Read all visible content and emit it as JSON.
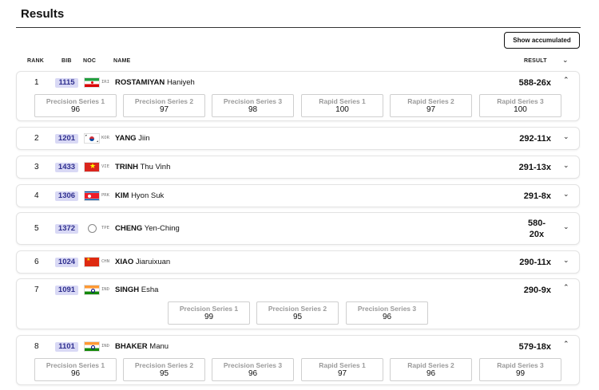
{
  "page": {
    "title": "Results",
    "show_accumulated_label": "Show accumulated"
  },
  "columns": {
    "rank": "RANK",
    "bib": "BIB",
    "noc": "NOC",
    "name": "NAME",
    "result": "RESULT"
  },
  "icons": {
    "expanded": "chevron-up-icon",
    "collapsed": "chevron-down-icon"
  },
  "rows": [
    {
      "rank": "1",
      "bib": "1115",
      "noc": "IRI",
      "surname": "ROSTAMIYAN",
      "given": "Haniyeh",
      "result": "588-26x",
      "expanded": true,
      "series": [
        {
          "label": "Precision Series 1",
          "value": "96"
        },
        {
          "label": "Precision Series 2",
          "value": "97"
        },
        {
          "label": "Precision Series 3",
          "value": "98"
        },
        {
          "label": "Rapid Series 1",
          "value": "100"
        },
        {
          "label": "Rapid Series 2",
          "value": "97"
        },
        {
          "label": "Rapid Series 3",
          "value": "100"
        }
      ]
    },
    {
      "rank": "2",
      "bib": "1201",
      "noc": "KOR",
      "surname": "YANG",
      "given": "Jiin",
      "result": "292-11x",
      "expanded": false
    },
    {
      "rank": "3",
      "bib": "1433",
      "noc": "VIE",
      "surname": "TRINH",
      "given": "Thu Vinh",
      "result": "291-13x",
      "expanded": false
    },
    {
      "rank": "4",
      "bib": "1306",
      "noc": "PRK",
      "surname": "KIM",
      "given": "Hyon Suk",
      "result": "291-8x",
      "expanded": false
    },
    {
      "rank": "5",
      "bib": "1372",
      "noc": "TPE",
      "surname": "CHENG",
      "given": "Yen-Ching",
      "result_line1": "580-",
      "result_line2": "20x",
      "expanded": false
    },
    {
      "rank": "6",
      "bib": "1024",
      "noc": "CHN",
      "surname": "XIAO",
      "given": "Jiaruixuan",
      "result": "290-11x",
      "expanded": false
    },
    {
      "rank": "7",
      "bib": "1091",
      "noc": "IND",
      "surname": "SINGH",
      "given": "Esha",
      "result": "290-9x",
      "expanded": true,
      "series": [
        {
          "label": "Precision Series 1",
          "value": "99"
        },
        {
          "label": "Precision Series 2",
          "value": "95"
        },
        {
          "label": "Precision Series 3",
          "value": "96"
        }
      ]
    },
    {
      "rank": "8",
      "bib": "1101",
      "noc": "IND",
      "surname": "BHAKER",
      "given": "Manu",
      "result": "579-18x",
      "expanded": true,
      "series": [
        {
          "label": "Precision Series 1",
          "value": "96"
        },
        {
          "label": "Precision Series 2",
          "value": "95"
        },
        {
          "label": "Precision Series 3",
          "value": "96"
        },
        {
          "label": "Rapid Series 1",
          "value": "97"
        },
        {
          "label": "Rapid Series 2",
          "value": "96"
        },
        {
          "label": "Rapid Series 3",
          "value": "99"
        }
      ]
    }
  ]
}
